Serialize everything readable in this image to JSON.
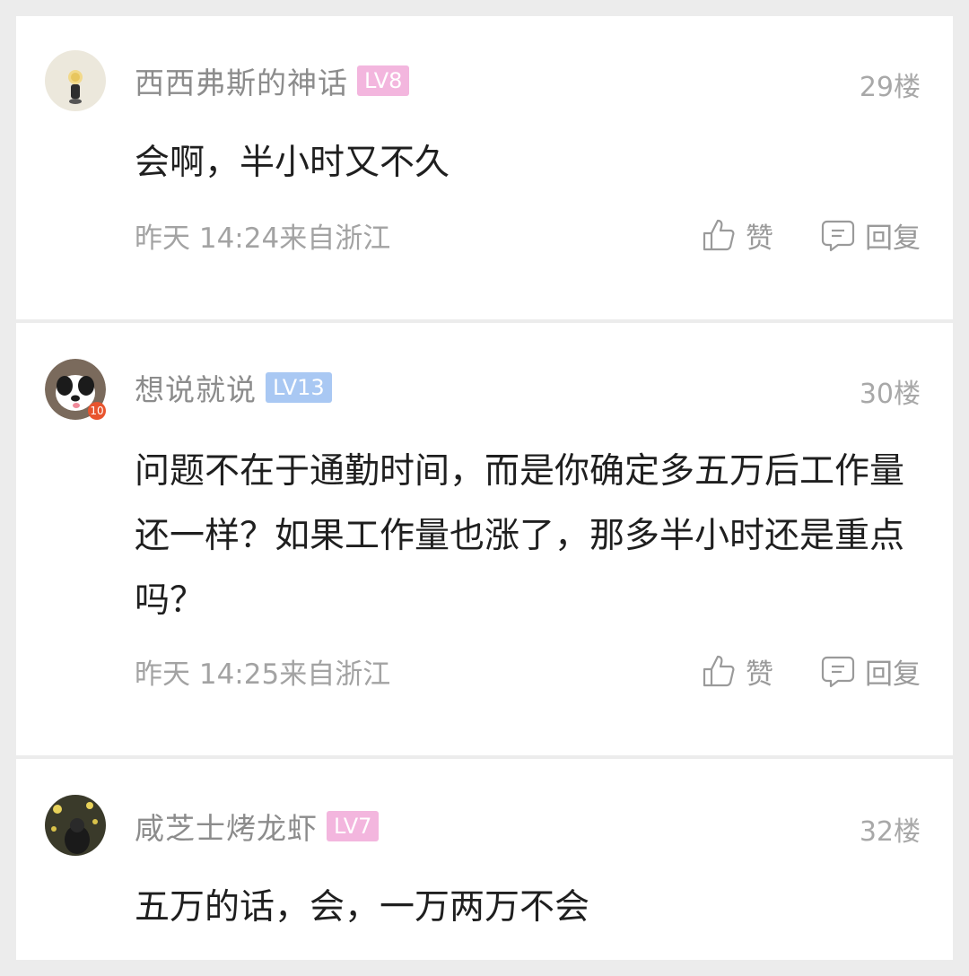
{
  "comments": [
    {
      "username": "西西弗斯的神话",
      "level": "LV8",
      "level_color": "#f3b6de",
      "floor": "29楼",
      "content": "会啊，半小时又不久",
      "time": "昨天 14:24来自浙江",
      "like_label": "赞",
      "reply_label": "回复"
    },
    {
      "username": "想说就说",
      "level": "LV13",
      "level_color": "#a9c8f3",
      "floor": "30楼",
      "content": "问题不在于通勤时间，而是你确定多五万后工作量还一样？如果工作量也涨了，那多半小时还是重点吗？",
      "time": "昨天 14:25来自浙江",
      "like_label": "赞",
      "reply_label": "回复",
      "avatar_badge": "10"
    },
    {
      "username": "咸芝士烤龙虾",
      "level": "LV7",
      "level_color": "#f3b6de",
      "floor": "32楼",
      "content": "五万的话，会，一万两万不会"
    }
  ]
}
